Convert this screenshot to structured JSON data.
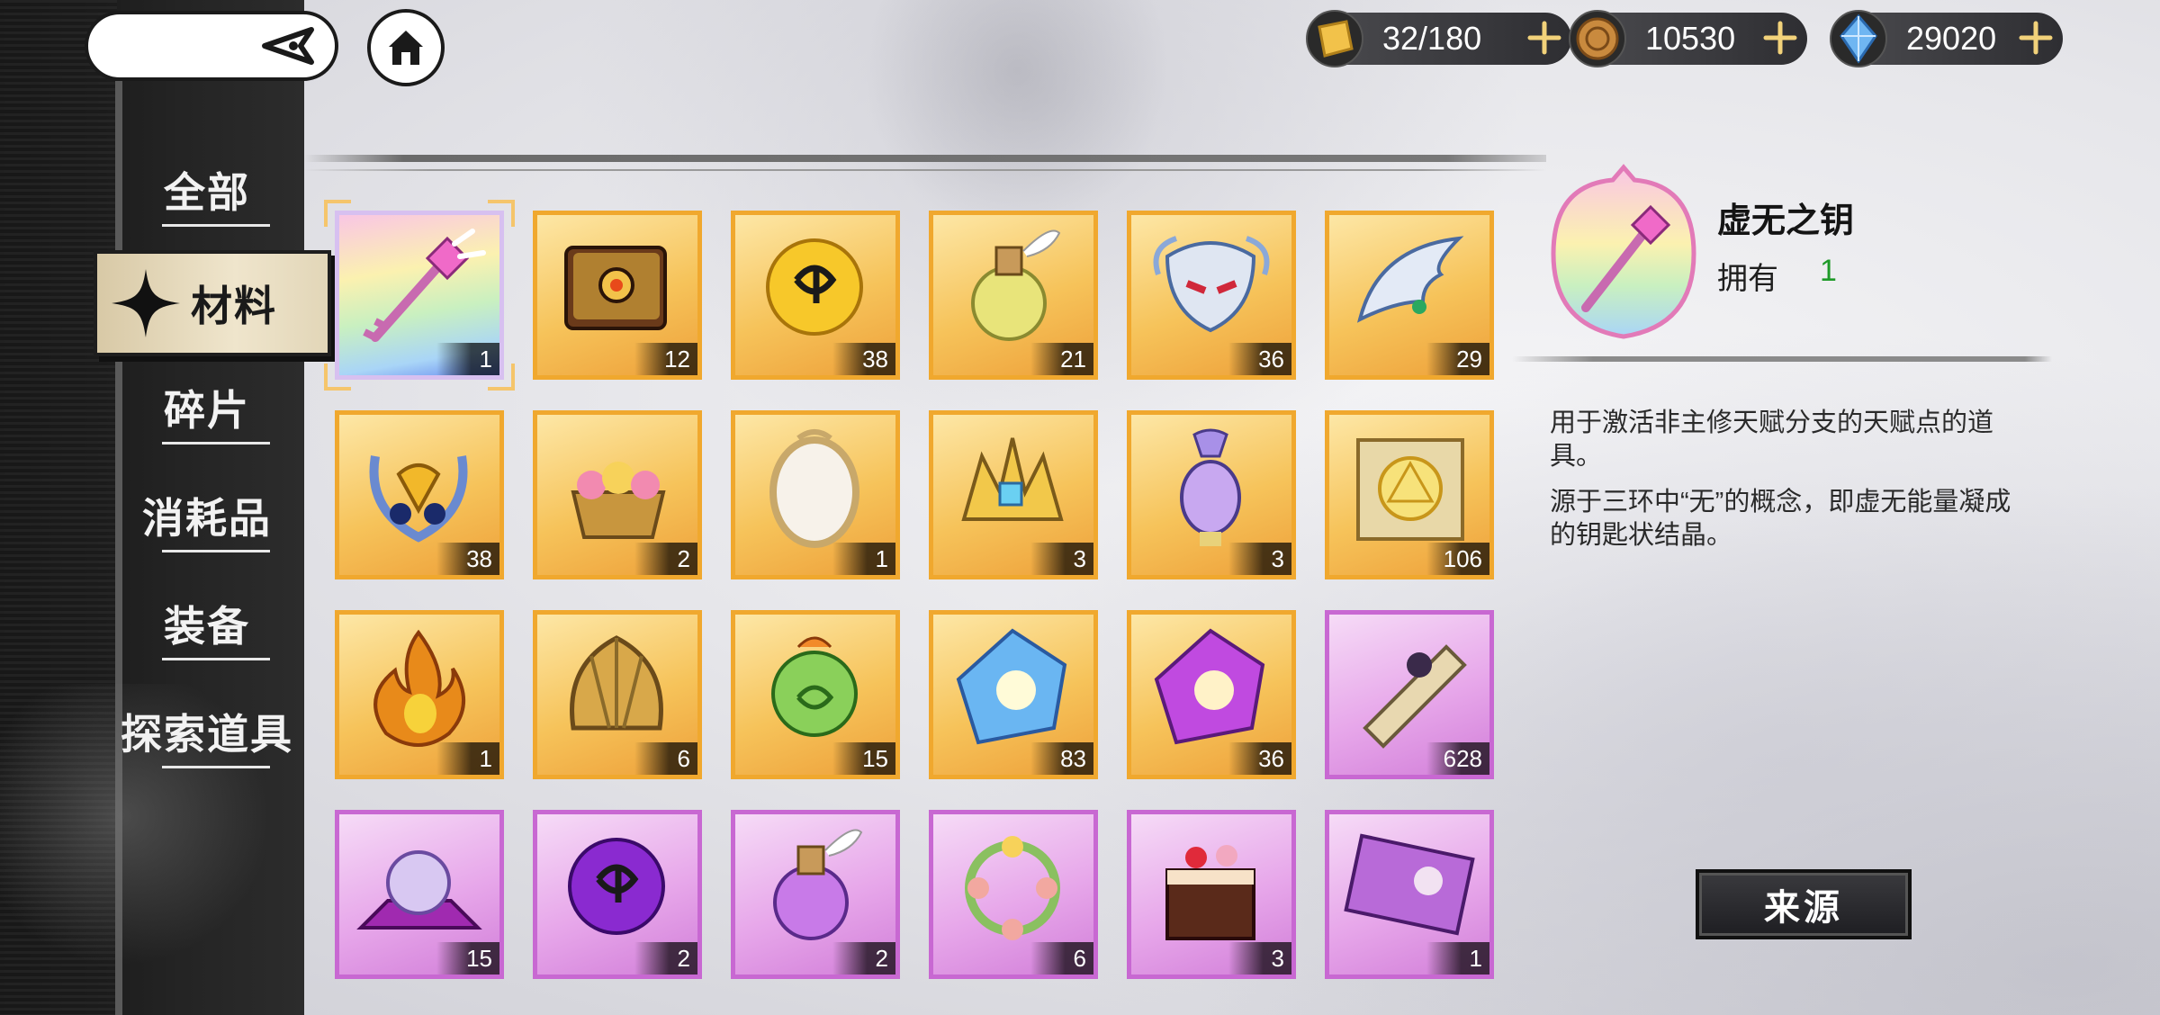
{
  "topbar": {
    "resources": [
      {
        "name": "stamina",
        "icon": "golden-card-icon",
        "value": "32/180"
      },
      {
        "name": "coins",
        "icon": "bronze-coin-icon",
        "value": "10530"
      },
      {
        "name": "crystals",
        "icon": "blue-crystal-icon",
        "value": "29020"
      }
    ]
  },
  "sidebar": {
    "items": [
      {
        "label": "全部"
      },
      {
        "label": "材料"
      },
      {
        "label": "碎片"
      },
      {
        "label": "消耗品"
      },
      {
        "label": "装备"
      },
      {
        "label": "探索道具"
      }
    ],
    "active_index": 1
  },
  "inventory": {
    "items": [
      {
        "name": "void-key",
        "rarity": "rainbow",
        "count": "1"
      },
      {
        "name": "ancient-book",
        "rarity": "gold",
        "count": "12"
      },
      {
        "name": "gold-rune-orb",
        "rarity": "gold",
        "count": "38"
      },
      {
        "name": "gold-potion",
        "rarity": "gold",
        "count": "21"
      },
      {
        "name": "silver-mask",
        "rarity": "gold",
        "count": "36"
      },
      {
        "name": "silver-wing",
        "rarity": "gold",
        "count": "29"
      },
      {
        "name": "laurel-emblem",
        "rarity": "gold",
        "count": "38"
      },
      {
        "name": "flower-basket",
        "rarity": "gold",
        "count": "2"
      },
      {
        "name": "ornate-mirror",
        "rarity": "gold",
        "count": "1"
      },
      {
        "name": "gold-crown",
        "rarity": "gold",
        "count": "3"
      },
      {
        "name": "perfume-bottle",
        "rarity": "gold",
        "count": "3"
      },
      {
        "name": "magic-scroll",
        "rarity": "gold",
        "count": "106"
      },
      {
        "name": "flame",
        "rarity": "gold",
        "count": "1"
      },
      {
        "name": "gold-shell",
        "rarity": "gold",
        "count": "6"
      },
      {
        "name": "green-seed",
        "rarity": "gold",
        "count": "15"
      },
      {
        "name": "blue-crystal",
        "rarity": "gold",
        "count": "83"
      },
      {
        "name": "purple-crystal",
        "rarity": "gold",
        "count": "36"
      },
      {
        "name": "sealed-scroll",
        "rarity": "purple",
        "count": "628"
      },
      {
        "name": "crystal-cushion",
        "rarity": "purple",
        "count": "15"
      },
      {
        "name": "purple-rune-orb",
        "rarity": "purple",
        "count": "2"
      },
      {
        "name": "purple-potion",
        "rarity": "purple",
        "count": "2"
      },
      {
        "name": "flower-wreath",
        "rarity": "purple",
        "count": "6"
      },
      {
        "name": "chocolate-cake",
        "rarity": "purple",
        "count": "3"
      },
      {
        "name": "photo-card",
        "rarity": "purple",
        "count": "1"
      }
    ],
    "selected_index": 0
  },
  "detail": {
    "name": "虚无之钥",
    "owned_label": "拥有",
    "owned_value": "1",
    "desc1": "用于激活非主修天赋分支的天赋点的道具。",
    "desc2": "源于三环中“无”的概念，即虚无能量凝成的钥匙状结晶。",
    "source_button": "来源"
  },
  "colors": {
    "owned_value": "#1e9a28",
    "gold_border": "#f0a82e",
    "purple_border": "#c868d2"
  }
}
